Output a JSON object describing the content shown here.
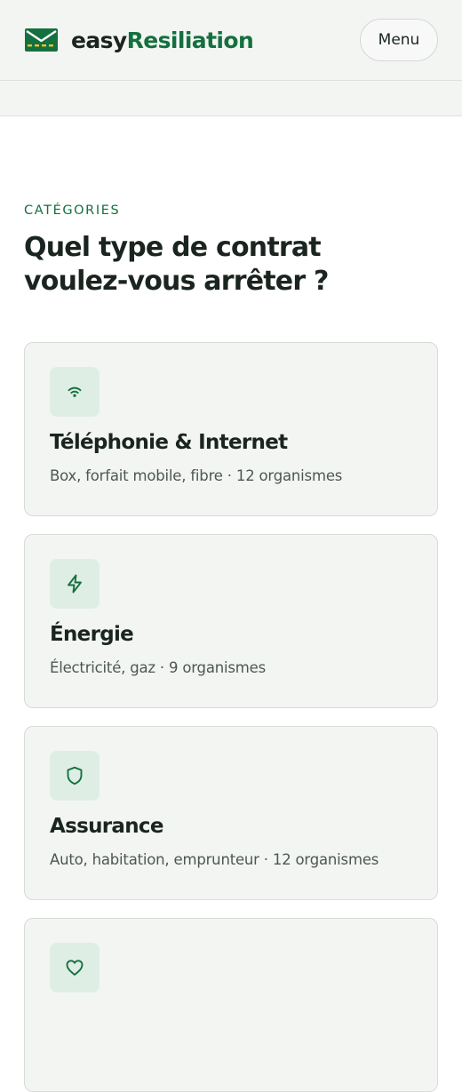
{
  "header": {
    "brand_prefix": "easy",
    "brand_suffix": "Resiliation",
    "menu_label": "Menu"
  },
  "section": {
    "eyebrow": "CATÉGORIES",
    "title_line1": "Quel type de contrat",
    "title_line2": "voulez-vous arrêter ?"
  },
  "categories": [
    {
      "title": "Téléphonie & Internet",
      "description": "Box, forfait mobile, fibre · 12 organismes",
      "icon": "wifi-icon"
    },
    {
      "title": "Énergie",
      "description": "Électricité, gaz · 9 organismes",
      "icon": "lightning-icon"
    },
    {
      "title": "Assurance",
      "description": "Auto, habitation, emprunteur · 12 organismes",
      "icon": "shield-icon"
    },
    {
      "title": "",
      "description": "",
      "icon": "heart-icon"
    }
  ],
  "colors": {
    "brand_green": "#14703f",
    "icon_tile_bg": "#dfeee5",
    "card_bg": "#f3f5f3"
  }
}
